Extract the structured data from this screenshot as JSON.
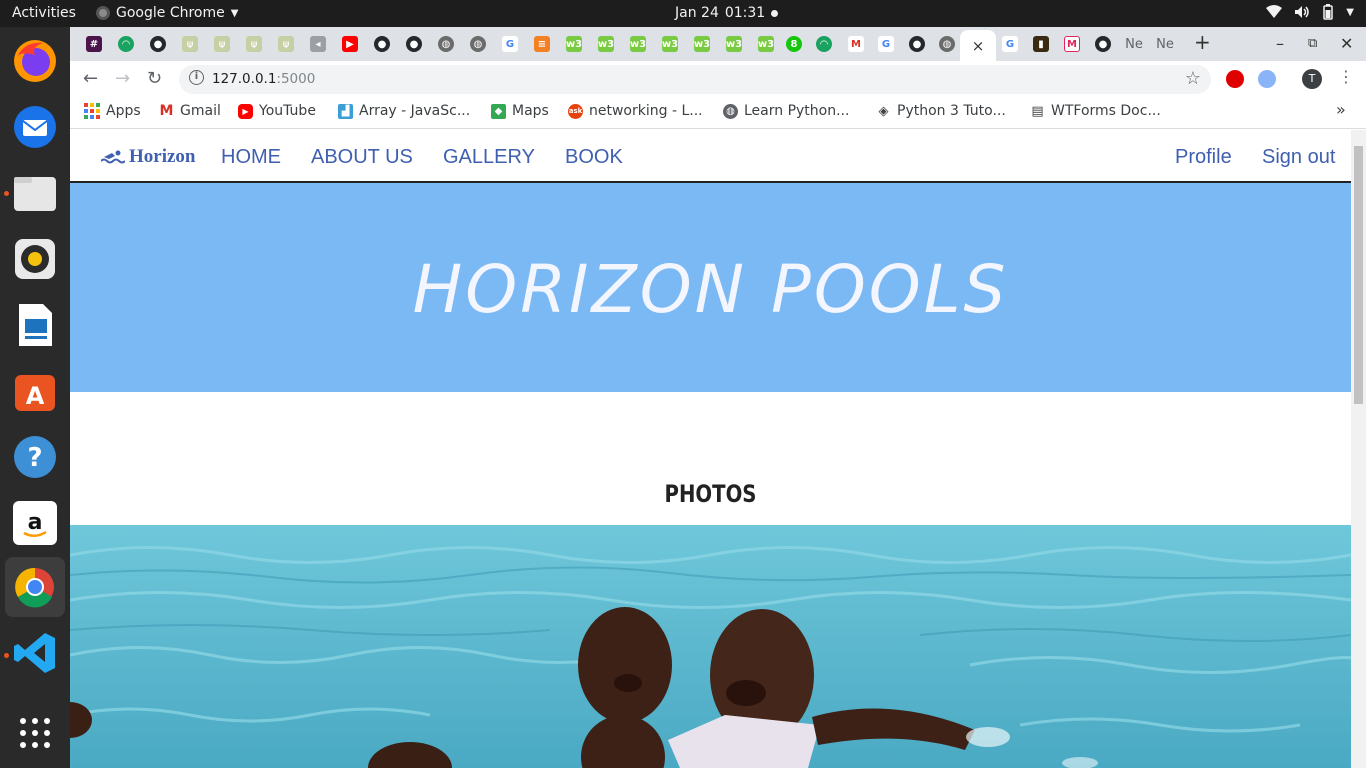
{
  "system": {
    "activities": "Activities",
    "app_name": "Google Chrome",
    "date": "Jan 24",
    "time": "01:31"
  },
  "browser": {
    "url_host": "127.0.0.1",
    "url_port": ":5000",
    "avatar_letter": "T",
    "tab_close_glyph": "×",
    "new_tab_glyph": "+",
    "tab_text_favicon_a": "Ne",
    "tab_text_favicon_b": "Ne",
    "bookmarks": [
      {
        "label": "Apps"
      },
      {
        "label": "Gmail"
      },
      {
        "label": "YouTube"
      },
      {
        "label": "Array - JavaSc..."
      },
      {
        "label": "Maps"
      },
      {
        "label": "networking - L..."
      },
      {
        "label": "Learn Python..."
      },
      {
        "label": "Python 3 Tuto..."
      },
      {
        "label": "WTForms Doc..."
      }
    ],
    "bookmarks_overflow": "»"
  },
  "site": {
    "brand": "Horizon",
    "nav": {
      "home": "HOME",
      "about": "ABOUT US",
      "gallery": "GALLERY",
      "book": "BOOK",
      "profile": "Profile",
      "signout": "Sign out"
    },
    "hero_title": "HORIZON POOLS",
    "section_heading": "PHOTOS",
    "colors": {
      "nav_link": "#3f5fb0",
      "hero_bg": "#7ab9f3",
      "hero_text": "#f4f6ff",
      "pool_water": "#5fbfd3"
    }
  }
}
